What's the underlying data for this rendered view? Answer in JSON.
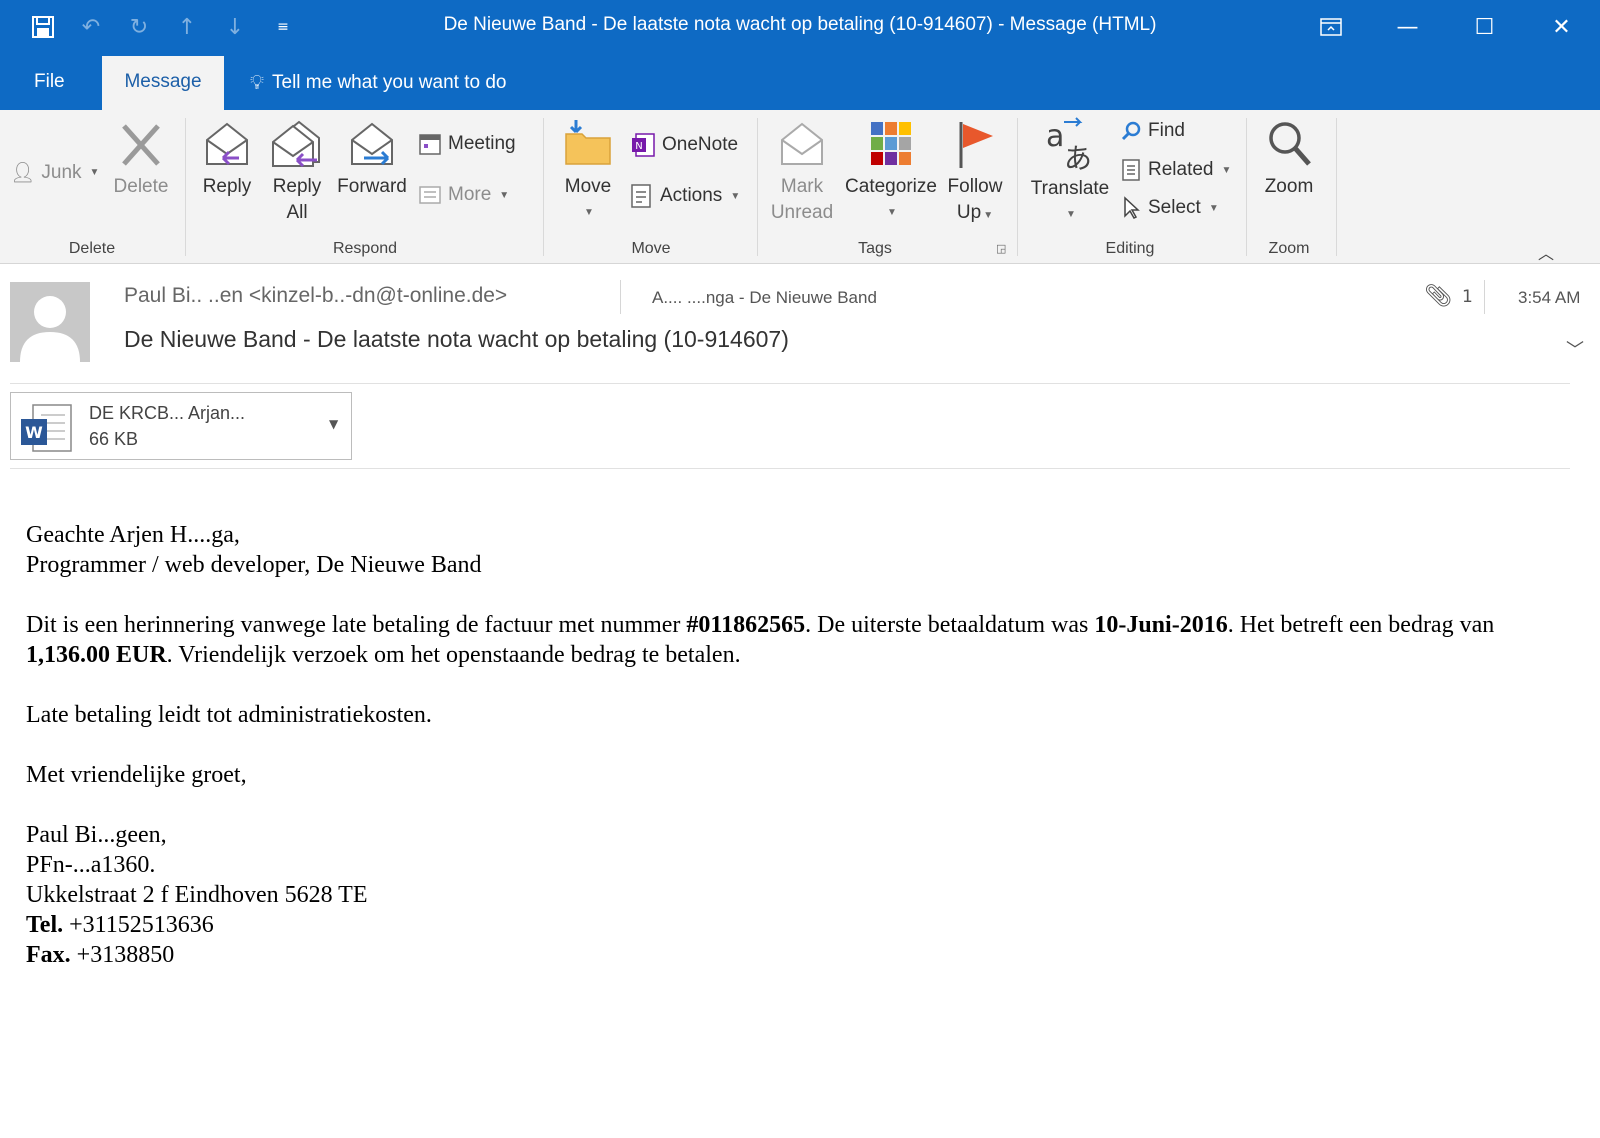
{
  "window": {
    "title": "De Nieuwe Band - De laatste nota wacht op betaling (10-914607) - Message (HTML)"
  },
  "tabs": {
    "file": "File",
    "message": "Message",
    "tell_me": "Tell me what you want to do"
  },
  "ribbon": {
    "delete_group": {
      "label": "Delete",
      "junk": "Junk",
      "delete": "Delete"
    },
    "respond_group": {
      "label": "Respond",
      "reply": "Reply",
      "reply_all_1": "Reply",
      "reply_all_2": "All",
      "forward": "Forward",
      "meeting": "Meeting",
      "more": "More"
    },
    "move_group": {
      "label": "Move",
      "move": "Move",
      "onenote": "OneNote",
      "actions": "Actions"
    },
    "tags_group": {
      "label": "Tags",
      "mark_unread_1": "Mark",
      "mark_unread_2": "Unread",
      "categorize": "Categorize",
      "follow_up_1": "Follow",
      "follow_up_2": "Up"
    },
    "editing_group": {
      "label": "Editing",
      "translate": "Translate",
      "find": "Find",
      "related": "Related",
      "select": "Select"
    },
    "zoom_group": {
      "label": "Zoom",
      "zoom": "Zoom"
    }
  },
  "message": {
    "sender": "Paul Bi.. ..en <kinzel-b..-dn@t-online.de>",
    "to": "A.... ....nga - De Nieuwe Band",
    "attachment_count": "1",
    "time": "3:54 AM",
    "subject": "De Nieuwe Band - De laatste nota wacht op betaling (10-914607)"
  },
  "attachment": {
    "name": "DE KRCB... Arjan...",
    "size": "66 KB"
  },
  "body": {
    "greeting": "Geachte Arjen H....ga,",
    "role": "Programmer / web developer, De Nieuwe Band",
    "p1_a": "Dit is een herinnering vanwege late betaling de factuur met nummer ",
    "invoice": "#011862565",
    "p1_b": ". De uiterste betaaldatum was ",
    "due_date": "10-Juni-2016",
    "p1_c": ". Het betreft een bedrag van ",
    "amount": "1,136.00 EUR",
    "p1_d": ". Vriendelijk verzoek om het openstaande bedrag te betalen.",
    "p2": "Late betaling leidt tot administratiekosten.",
    "closing": "Met vriendelijke groet,",
    "sig_name": "Paul Bi...geen,",
    "sig_company": "PFn-...a1360.",
    "sig_address": "Ukkelstraat 2 f Eindhoven 5628 TE",
    "tel_label": "Tel.",
    "tel": " +31152513636",
    "fax_label": "Fax.",
    "fax": " +3138850"
  }
}
